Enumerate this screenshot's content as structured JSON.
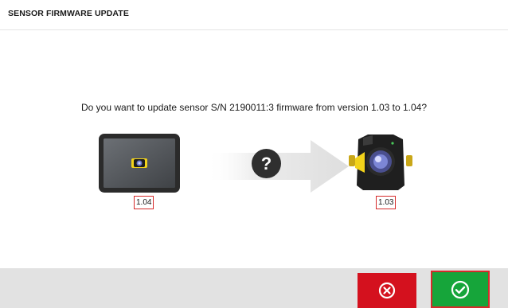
{
  "header": {
    "title": "SENSOR FIRMWARE UPDATE"
  },
  "dialog": {
    "question": "Do you want to update sensor S/N 2190011:3 firmware from version 1.03 to 1.04?",
    "target_version": "1.04",
    "current_version": "1.03",
    "help_symbol": "?"
  },
  "footer": {
    "cancel_icon": "close-circle-icon",
    "confirm_icon": "check-circle-icon"
  },
  "colors": {
    "cancel": "#d4111e",
    "confirm": "#16a53a",
    "highlight_border": "#d62b2b",
    "footer_bg": "#e2e2e2",
    "sensor_accent": "#f2d21a"
  }
}
